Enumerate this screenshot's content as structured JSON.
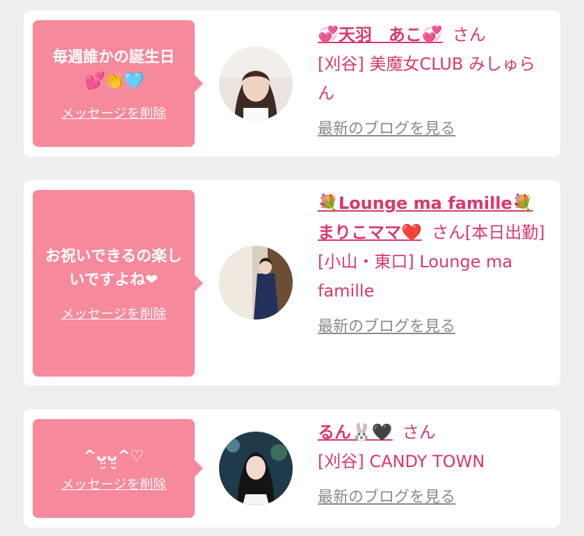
{
  "cards": [
    {
      "message_text": "毎週誰かの誕生日",
      "message_emoji": "💕👏🩵",
      "delete_label": "メッセージを削除",
      "cast_name": "💞天羽　あこ💞",
      "honorific": "さん",
      "shop": "[刈谷] 美魔女CLUB みしゅらん",
      "blog_link": "最新のブログを見る"
    },
    {
      "message_text": "お祝いできるの楽しいですよね❤︎",
      "delete_label": "メッセージを削除",
      "cast_name": "💐Lounge ma famille💐まりこママ❤️",
      "honorific": "さん",
      "status": "[本日出勤]",
      "shop": "[小山・東口] Lounge ma famille",
      "blog_link": "最新のブログを見る"
    },
    {
      "message_text": "^ᴗ̤̮ᴗ̤̮^♡",
      "delete_label": "メッセージを削除",
      "cast_name": "るん🐰🖤",
      "honorific": "さん",
      "shop": "[刈谷] CANDY TOWN",
      "blog_link": "最新のブログを見る"
    }
  ],
  "colors": {
    "accent": "#d9386a",
    "bubble": "#f7899c",
    "background": "#efefef",
    "link_gray": "#8a8a8a"
  }
}
